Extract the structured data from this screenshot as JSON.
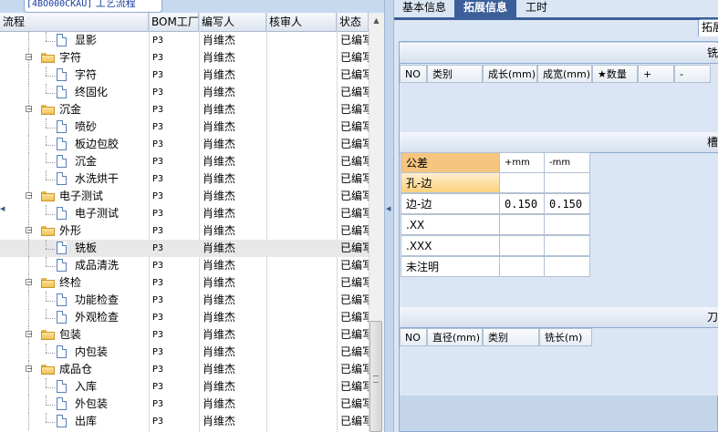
{
  "left_tab": {
    "code": "[4BO000CKAU]",
    "title": "工艺流程"
  },
  "tree": {
    "columns": [
      "流程",
      "BOM工厂",
      "编写人",
      "核审人",
      "状态"
    ],
    "rows": [
      {
        "level": 2,
        "label": "显影",
        "factory": "P3",
        "author": "肖维杰",
        "reviewer": "",
        "status": "已编写"
      },
      {
        "level": 1,
        "label": "字符",
        "factory": "P3",
        "author": "肖维杰",
        "reviewer": "",
        "status": "已编写"
      },
      {
        "level": 2,
        "label": "字符",
        "factory": "P3",
        "author": "肖维杰",
        "reviewer": "",
        "status": "已编写"
      },
      {
        "level": 2,
        "label": "终固化",
        "factory": "P3",
        "author": "肖维杰",
        "reviewer": "",
        "status": "已编写"
      },
      {
        "level": 1,
        "label": "沉金",
        "factory": "P3",
        "author": "肖维杰",
        "reviewer": "",
        "status": "已编写"
      },
      {
        "level": 2,
        "label": "喷砂",
        "factory": "P3",
        "author": "肖维杰",
        "reviewer": "",
        "status": "已编写"
      },
      {
        "level": 2,
        "label": "板边包胶",
        "factory": "P3",
        "author": "肖维杰",
        "reviewer": "",
        "status": "已编写"
      },
      {
        "level": 2,
        "label": "沉金",
        "factory": "P3",
        "author": "肖维杰",
        "reviewer": "",
        "status": "已编写"
      },
      {
        "level": 2,
        "label": "水洗烘干",
        "factory": "P3",
        "author": "肖维杰",
        "reviewer": "",
        "status": "已编写"
      },
      {
        "level": 1,
        "label": "电子测试",
        "factory": "P3",
        "author": "肖维杰",
        "reviewer": "",
        "status": "已编写"
      },
      {
        "level": 2,
        "label": "电子测试",
        "factory": "P3",
        "author": "肖维杰",
        "reviewer": "",
        "status": "已编写"
      },
      {
        "level": 1,
        "label": "外形",
        "factory": "P3",
        "author": "肖维杰",
        "reviewer": "",
        "status": "已编写"
      },
      {
        "level": 2,
        "label": "铣板",
        "factory": "P3",
        "author": "肖维杰",
        "reviewer": "",
        "status": "已编写",
        "selected": true
      },
      {
        "level": 2,
        "label": "成品清洗",
        "factory": "P3",
        "author": "肖维杰",
        "reviewer": "",
        "status": "已编写"
      },
      {
        "level": 1,
        "label": "终检",
        "factory": "P3",
        "author": "肖维杰",
        "reviewer": "",
        "status": "已编写"
      },
      {
        "level": 2,
        "label": "功能检查",
        "factory": "P3",
        "author": "肖维杰",
        "reviewer": "",
        "status": "已编写"
      },
      {
        "level": 2,
        "label": "外观检查",
        "factory": "P3",
        "author": "肖维杰",
        "reviewer": "",
        "status": "已编写"
      },
      {
        "level": 1,
        "label": "包装",
        "factory": "P3",
        "author": "肖维杰",
        "reviewer": "",
        "status": "已编写"
      },
      {
        "level": 2,
        "label": "内包装",
        "factory": "P3",
        "author": "肖维杰",
        "reviewer": "",
        "status": "已编写"
      },
      {
        "level": 1,
        "label": "成品仓",
        "factory": "P3",
        "author": "肖维杰",
        "reviewer": "",
        "status": "已编写"
      },
      {
        "level": 2,
        "label": "入库",
        "factory": "P3",
        "author": "肖维杰",
        "reviewer": "",
        "status": "已编写"
      },
      {
        "level": 2,
        "label": "外包装",
        "factory": "P3",
        "author": "肖维杰",
        "reviewer": "",
        "status": "已编写"
      },
      {
        "level": 2,
        "label": "出库",
        "factory": "P3",
        "author": "肖维杰",
        "reviewer": "",
        "status": "已编写"
      }
    ]
  },
  "right_tabs": [
    "基本信息",
    "拓展信息",
    "工时"
  ],
  "active_tab": "拓展信息",
  "sub_tab": "拓展",
  "sections": {
    "mill": {
      "title": "铣",
      "columns": [
        "NO",
        "类别",
        "成长(mm)",
        "成宽(mm)",
        "★数量",
        "+",
        "-"
      ]
    },
    "slot": {
      "title": "槽",
      "header": [
        "公差",
        "+mm",
        "-mm"
      ],
      "rows": [
        {
          "label": "孔-边",
          "plus": "",
          "minus": ""
        },
        {
          "label": "边-边",
          "plus": "0.150",
          "minus": "0.150"
        },
        {
          "label": ".XX",
          "plus": "",
          "minus": ""
        },
        {
          "label": ".XXX",
          "plus": "",
          "minus": ""
        },
        {
          "label": "未注明",
          "plus": "",
          "minus": ""
        }
      ]
    },
    "tool": {
      "title": "刀",
      "columns": [
        "NO",
        "直径(mm)",
        "类别",
        "铣长(m)"
      ]
    }
  },
  "colors": {
    "active_tab": "#3d5f99",
    "highlight_orange": "#f6c57f",
    "panel_bg": "#c4d5ea"
  }
}
